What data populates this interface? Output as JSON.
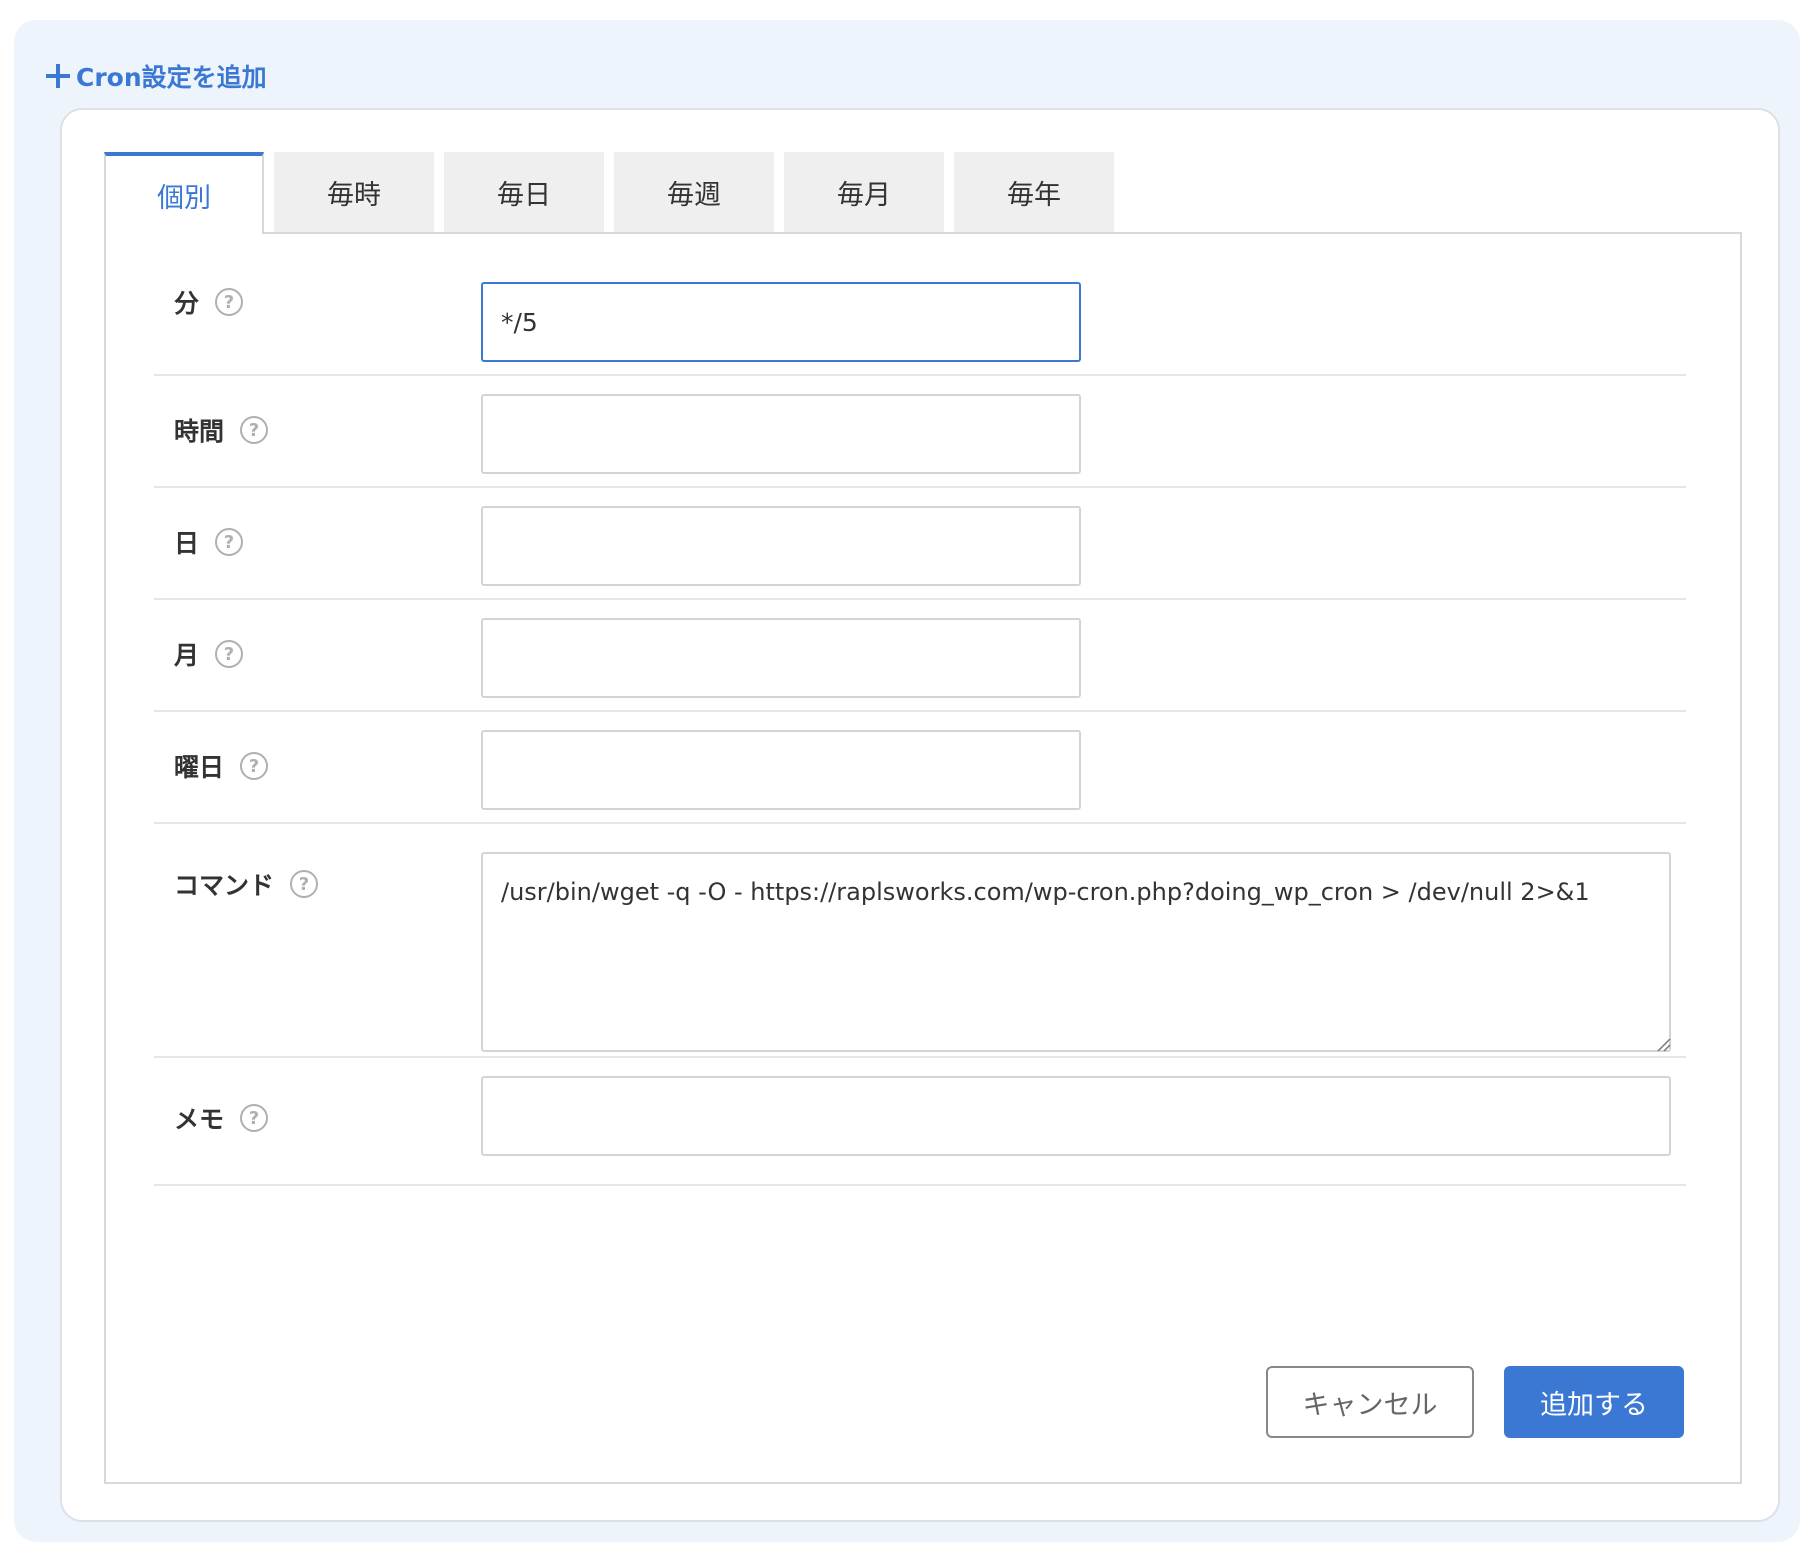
{
  "header": {
    "title": "Cron設定を追加"
  },
  "tabs": [
    {
      "label": "個別",
      "active": true
    },
    {
      "label": "毎時",
      "active": false
    },
    {
      "label": "毎日",
      "active": false
    },
    {
      "label": "毎週",
      "active": false
    },
    {
      "label": "毎月",
      "active": false
    },
    {
      "label": "毎年",
      "active": false
    }
  ],
  "form": {
    "minute": {
      "label": "分",
      "value": "*/5"
    },
    "hour": {
      "label": "時間",
      "value": ""
    },
    "day": {
      "label": "日",
      "value": ""
    },
    "month": {
      "label": "月",
      "value": ""
    },
    "weekday": {
      "label": "曜日",
      "value": ""
    },
    "command": {
      "label": "コマンド",
      "value": "/usr/bin/wget -q -O - https://raplsworks.com/wp-cron.php?doing_wp_cron > /dev/null 2>&1"
    },
    "memo": {
      "label": "メモ",
      "value": ""
    },
    "help_glyph": "?"
  },
  "actions": {
    "cancel_label": "キャンセル",
    "add_label": "追加する"
  },
  "colors": {
    "accent": "#3a78d4",
    "background": "#eef4fc"
  }
}
